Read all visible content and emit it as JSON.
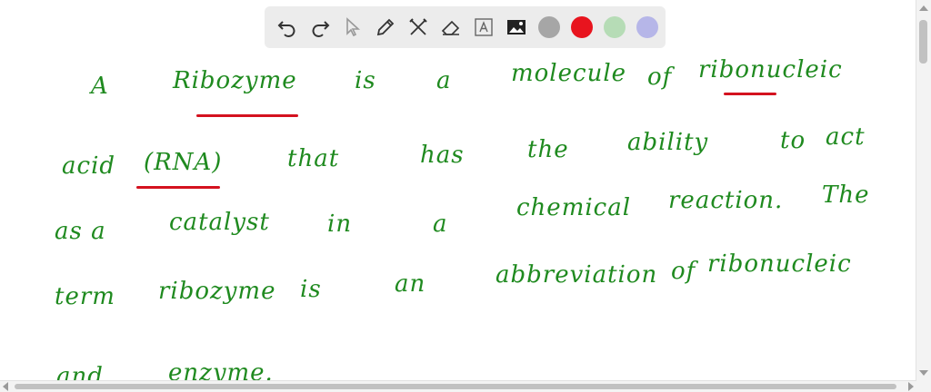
{
  "toolbar": {
    "tools": [
      "undo-icon",
      "redo-icon",
      "pointer-icon",
      "pen-icon",
      "tools-icon",
      "eraser-icon",
      "text-icon",
      "image-icon"
    ],
    "colors": [
      "#a6a6a6",
      "#e8141e",
      "#b6dcb6",
      "#b6b6e8"
    ]
  },
  "note": {
    "line1": [
      "A",
      "Ribozyme",
      "is",
      "a",
      "molecule",
      "of",
      "ribonucleic"
    ],
    "line2": [
      "acid",
      "(RNA)",
      "that",
      "has",
      "the",
      "ability",
      "to",
      "act"
    ],
    "line3": [
      "as a",
      "catalyst",
      "in",
      "a",
      "chemical",
      "reaction.",
      "The"
    ],
    "line4": [
      "term",
      "ribozyme",
      "is",
      "an",
      "abbreviation",
      "of",
      "ribonucleic"
    ],
    "line5": [
      "and",
      "enzyme."
    ]
  }
}
